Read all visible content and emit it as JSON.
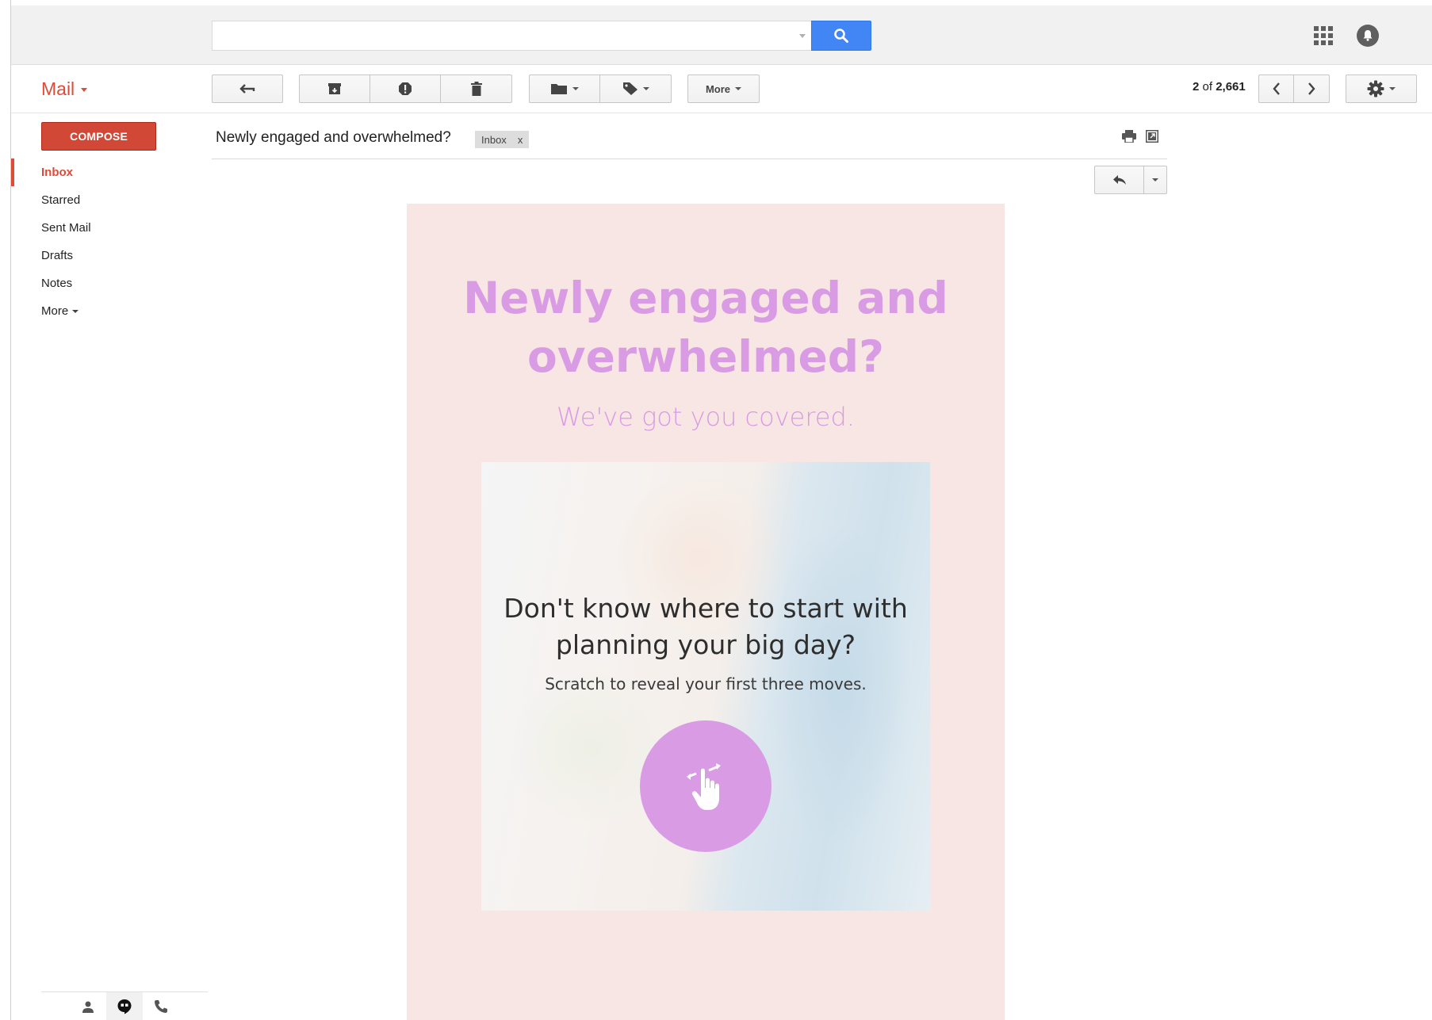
{
  "search": {
    "placeholder": "",
    "value": ""
  },
  "toolbar": {
    "app_title": "Mail",
    "more_label": "More",
    "pager": {
      "current": "2",
      "of": "of",
      "total": "2,661"
    }
  },
  "sidebar": {
    "compose_label": "COMPOSE",
    "items": [
      {
        "label": "Inbox",
        "active": true
      },
      {
        "label": "Starred"
      },
      {
        "label": "Sent Mail"
      },
      {
        "label": "Drafts"
      },
      {
        "label": "Notes"
      },
      {
        "label": "More"
      }
    ]
  },
  "message": {
    "subject": "Newly engaged and overwhelmed?",
    "label": "Inbox",
    "label_remove": "x"
  },
  "email": {
    "headline_line1": "Newly engaged and",
    "headline_line2": "overwhelmed?",
    "subheadline": "We've got you covered.",
    "hero_question_line1": "Don't know where to start with",
    "hero_question_line2": "planning your big day?",
    "hero_instruction": "Scratch to reveal your first three moves.",
    "accent_color": "#d99be3",
    "background_color": "#f7e6e3"
  },
  "colors": {
    "brand_red": "#dd4b39",
    "compose_red": "#d14836",
    "search_blue": "#4285f4"
  },
  "icons": [
    "search-icon",
    "apps-grid-icon",
    "notifications-icon",
    "back-arrow-icon",
    "archive-icon",
    "report-spam-icon",
    "trash-icon",
    "folder-icon",
    "tag-icon",
    "chevron-left-icon",
    "chevron-right-icon",
    "gear-icon",
    "print-icon",
    "new-window-icon",
    "reply-icon",
    "person-icon",
    "hangouts-icon",
    "phone-icon",
    "scratch-hand-icon"
  ]
}
